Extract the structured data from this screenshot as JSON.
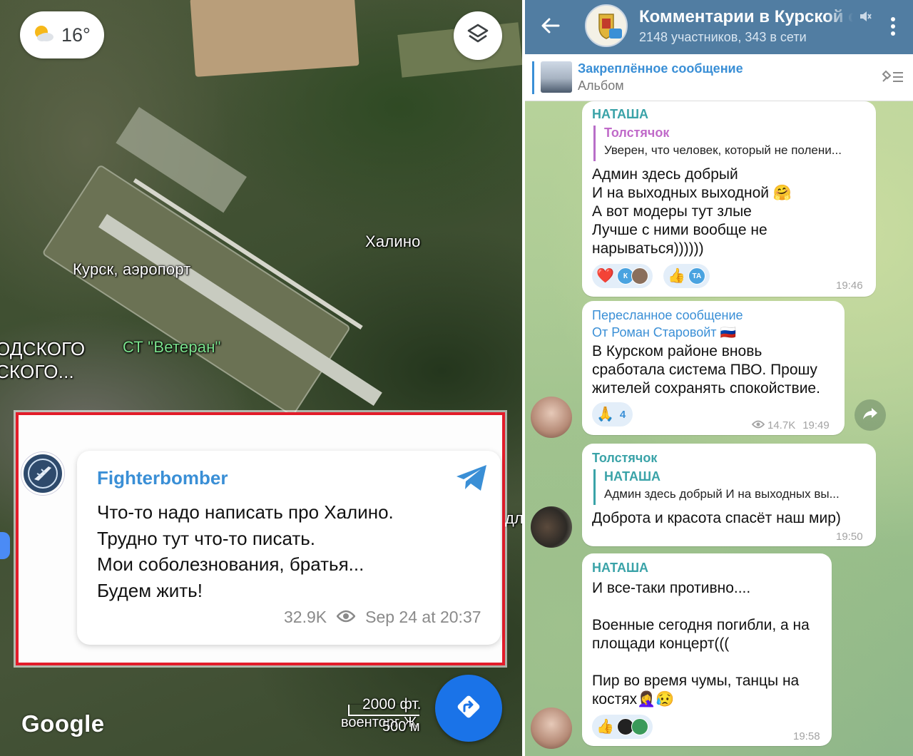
{
  "map": {
    "weather": {
      "temp": "16°",
      "icon": "partly-cloudy-icon"
    },
    "labels": {
      "airport": "Курск, аэропорт",
      "khalino": "Халино",
      "veteran": "СТ \"Ветеран\"",
      "left_fragment_1": "ОДСКОГО",
      "left_fragment_2": "СКОГО...",
      "edge_fragment": "дл"
    },
    "scale": {
      "feet": "2000 фт.",
      "meters": "500 м"
    },
    "scale_street_fragment": "военторг Ж",
    "google_logo": "Google"
  },
  "telegram_card": {
    "name": "Fighterbomber",
    "lines": [
      "Что-то надо написать про Халино.",
      "Трудно тут что-то писать.",
      "Мои соболезнования, братья...",
      "Будем жить!"
    ],
    "views": "32.9K",
    "date": "Sep 24 at 20:37"
  },
  "chat": {
    "title": "Комментарии в Курской о",
    "subtitle": "2148 участников, 343 в сети",
    "pinned": {
      "title": "Закреплённое сообщение",
      "subtitle": "Альбом"
    },
    "messages": [
      {
        "author": "НАТАША",
        "reply_name": "Толстячок",
        "reply_text": "Уверен, что человек, который не полени...",
        "text": "Админ здесь добрый\nИ на выходных выходной 🤗\nА вот модеры тут злые\nЛучше с ними вообще не\nнарываться))))))",
        "reactions": [
          {
            "emoji": "❤️",
            "avatars": [
              "К",
              ""
            ]
          },
          {
            "emoji": "👍",
            "avatars": [
              "ТА"
            ]
          }
        ],
        "time": "19:46"
      },
      {
        "forwarded_label": "Пересланное сообщение",
        "forwarded_from": "От Роман Старовойт 🇷🇺",
        "text": "В Курском районе вновь\nсработала система ПВО. Прошу\nжителей сохранять спокойствие.",
        "reaction": {
          "emoji": "🙏",
          "count": "4"
        },
        "views": "14.7K",
        "time": "19:49"
      },
      {
        "author": "Толстячок",
        "reply_name": "НАТАША",
        "reply_text": "Админ здесь добрый И на выходных вы...",
        "text": "Доброта и красота спасёт наш мир)",
        "time": "19:50"
      },
      {
        "author": "НАТАША",
        "text": "И все-таки противно....\n\nВоенные сегодня погибли, а на\nплощади концерт(((\n\nПир во время чумы, танцы на\nкостях🤦‍♀️😥",
        "reactions": [
          {
            "emoji": "👍",
            "avatars": [
              "",
              ""
            ]
          }
        ],
        "time": "19:58"
      }
    ]
  },
  "colors": {
    "frame_red": "#e21c2a",
    "telegram_header": "#517da2",
    "link_blue": "#3a8fd6",
    "author_teal": "#3aa3a8",
    "reply_purple": "#c06ac9"
  }
}
